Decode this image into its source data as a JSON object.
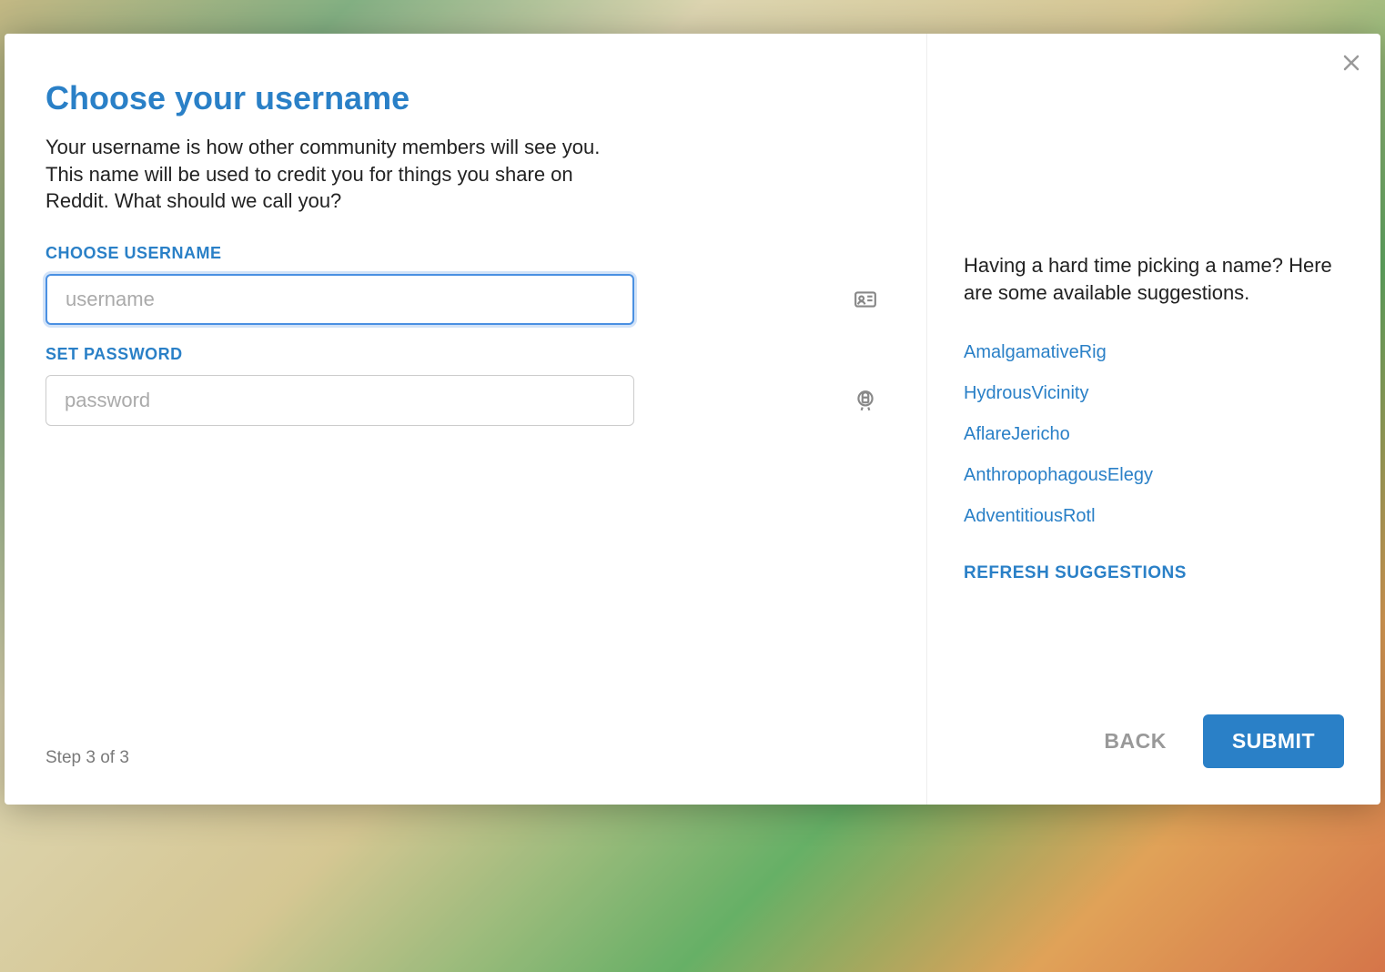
{
  "modal": {
    "title": "Choose your username",
    "subtitle": "Your username is how other community members will see you. This name will be used to credit you for things you share on Reddit. What should we call you?",
    "username_label": "CHOOSE USERNAME",
    "username_placeholder": "username",
    "username_value": "",
    "password_label": "SET PASSWORD",
    "password_placeholder": "password",
    "password_value": "",
    "step_indicator": "Step 3 of 3"
  },
  "suggestions": {
    "intro": "Having a hard time picking a name? Here are some available suggestions.",
    "items": [
      "AmalgamativeRig",
      "HydrousVicinity",
      "AflareJericho",
      "AnthropophagousElegy",
      "AdventitiousRotl"
    ],
    "refresh_label": "REFRESH SUGGESTIONS"
  },
  "actions": {
    "back_label": "BACK",
    "submit_label": "SUBMIT"
  }
}
